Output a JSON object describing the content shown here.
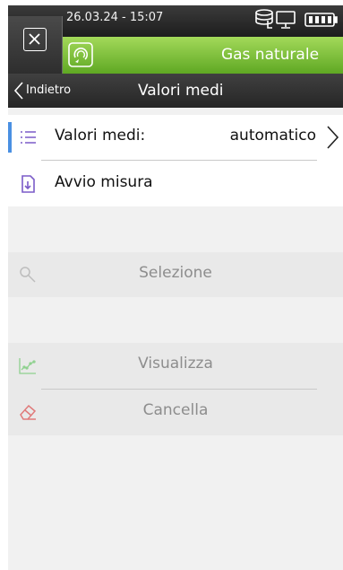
{
  "status": {
    "datetime": "26.03.24 - 15:07",
    "icons": [
      "database-icon",
      "monitor-icon",
      "battery-icon"
    ]
  },
  "header": {
    "close_icon": "close-icon",
    "app_icon": "gas-analyzer-icon",
    "title": "Gas naturale"
  },
  "nav": {
    "back_label": "Indietro",
    "title": "Valori medi"
  },
  "settings": [
    {
      "label": "Valori medi:",
      "value": "automatico",
      "icon": "list-icon"
    },
    {
      "label": "Avvio misura",
      "icon": "measurement-start-icon"
    }
  ],
  "actions": {
    "selection": {
      "label": "Selezione",
      "icon": "search-icon"
    },
    "view": {
      "label": "Visualizza",
      "icon": "chart-line-icon"
    },
    "delete": {
      "label": "Cancella",
      "icon": "eraser-icon"
    }
  },
  "colors": {
    "accent_green": "#7cc242",
    "accent_blue": "#4a90e2",
    "muted_text": "#8d8d8d"
  }
}
